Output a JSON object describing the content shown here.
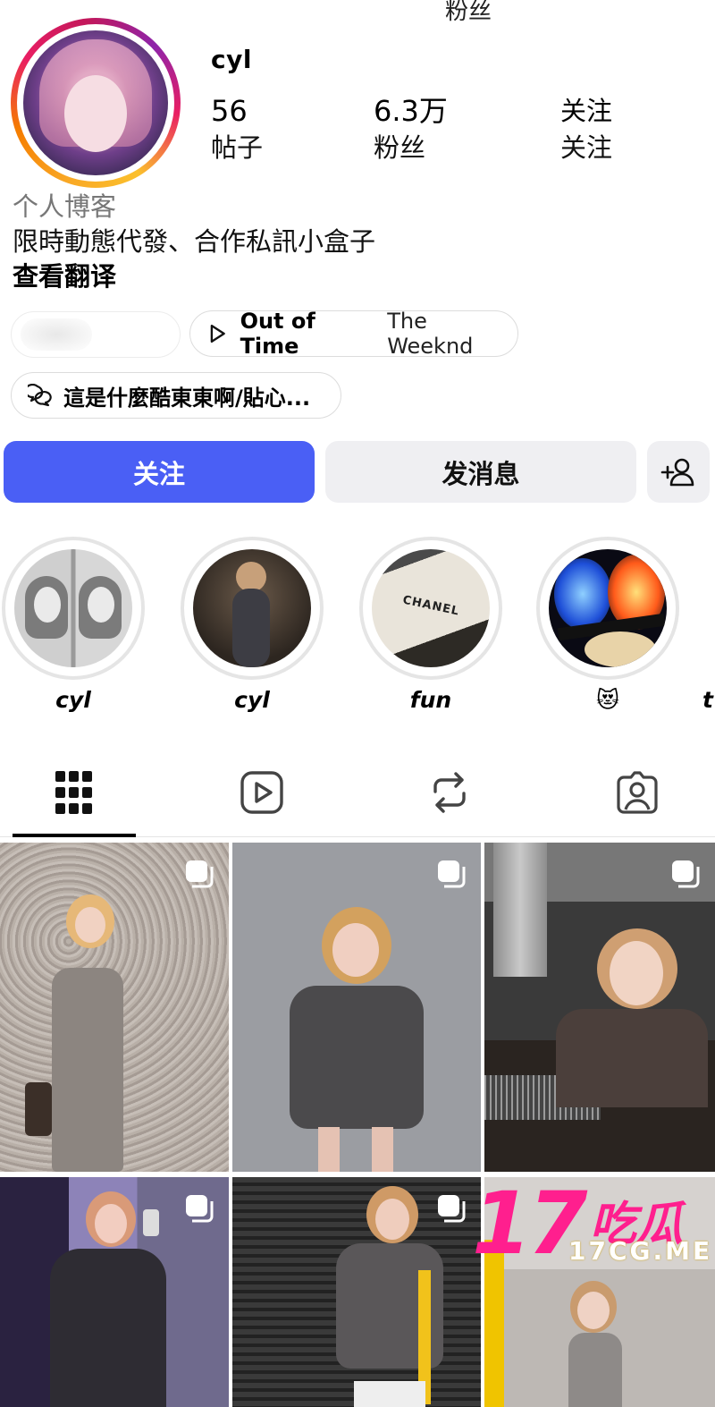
{
  "top_cut_text": "粉丝",
  "profile": {
    "username": "cyl",
    "stats": [
      {
        "number": "56",
        "label": "帖子"
      },
      {
        "number": "6.3万",
        "label": "粉丝"
      },
      {
        "number": "关注",
        "label": "关注"
      }
    ],
    "category": "个人博客",
    "bio": "限時動態代發、合作私訊小盒子",
    "translate_link": "查看翻译"
  },
  "music": {
    "title": "Out of Time",
    "artist": "The Weeknd"
  },
  "thread_pill": "這是什麼酷東東啊/貼心...",
  "buttons": {
    "follow": "关注",
    "message": "发消息"
  },
  "highlights": [
    {
      "caption": "cyl"
    },
    {
      "caption": "cyl"
    },
    {
      "caption": "fun"
    },
    {
      "caption": "😻"
    },
    {
      "caption": "t"
    }
  ],
  "highlight_brand_text": "CHANEL",
  "tabs": [
    "grid-icon",
    "reels-icon",
    "reposts-icon",
    "tagged-icon"
  ],
  "watermark": {
    "big": "17",
    "cn": "吃瓜",
    "url": "17CG.ME"
  },
  "colors": {
    "follow_button": "#4a5ff5",
    "watermark": "#ff1f8e"
  }
}
